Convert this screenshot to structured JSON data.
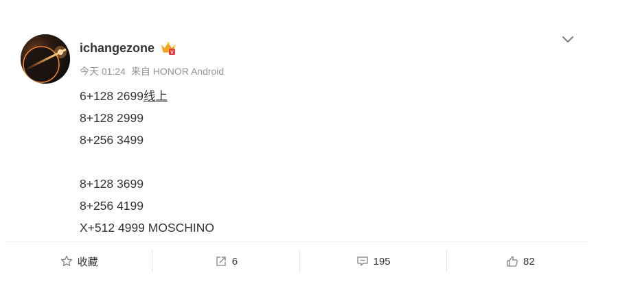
{
  "post": {
    "username": "ichangezone",
    "meta": {
      "time": "今天 01:24",
      "source_prefix": "来自",
      "source": "HONOR Android"
    },
    "lines": [
      {
        "text_before": "6+128 2699",
        "link_text": "线上"
      },
      {
        "text": "8+128 2999"
      },
      {
        "text": "8+256 3499"
      },
      {
        "text": ""
      },
      {
        "text": "8+128 3699"
      },
      {
        "text": "8+256 4199"
      },
      {
        "text": "X+512 4999 MOSCHINO"
      }
    ]
  },
  "actions": {
    "favorite_label": "收藏",
    "repost_count": "6",
    "comment_count": "195",
    "like_count": "82"
  },
  "icons": {
    "menu": "chevron-down-icon",
    "badge": "vip-crown-badge-icon",
    "favorite": "star-icon",
    "repost": "repost-icon",
    "comment": "comment-icon",
    "like": "thumbs-up-icon"
  },
  "colors": {
    "text": "#333333",
    "meta": "#939393",
    "icon": "#808080",
    "badge": "#f5a623"
  }
}
